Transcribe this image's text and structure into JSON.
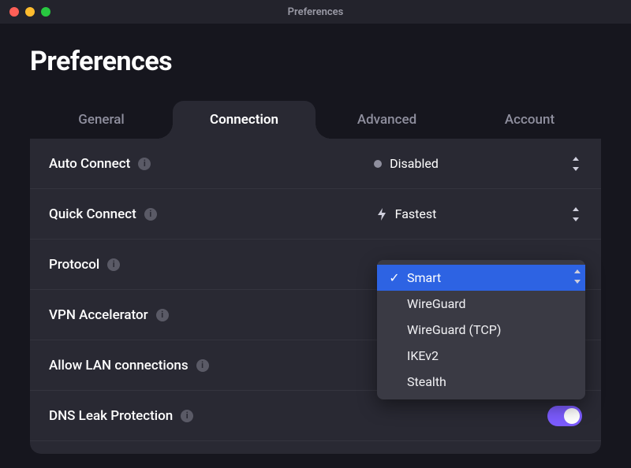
{
  "window": {
    "title": "Preferences"
  },
  "page": {
    "title": "Preferences"
  },
  "tabs": {
    "general": "General",
    "connection": "Connection",
    "advanced": "Advanced",
    "account": "Account",
    "active": "connection"
  },
  "rows": {
    "auto_connect": {
      "label": "Auto Connect",
      "value": "Disabled"
    },
    "quick_connect": {
      "label": "Quick Connect",
      "value": "Fastest"
    },
    "protocol": {
      "label": "Protocol",
      "value": "Smart"
    },
    "vpn_accelerator": {
      "label": "VPN Accelerator",
      "on": true
    },
    "allow_lan": {
      "label": "Allow LAN connections",
      "on": true
    },
    "dns_leak": {
      "label": "DNS Leak Protection",
      "on": true
    }
  },
  "protocol_menu": {
    "options": [
      "Smart",
      "WireGuard",
      "WireGuard (TCP)",
      "IKEv2",
      "Stealth"
    ],
    "selected": "Smart"
  },
  "icons": {
    "info": "i",
    "check": "✓"
  }
}
